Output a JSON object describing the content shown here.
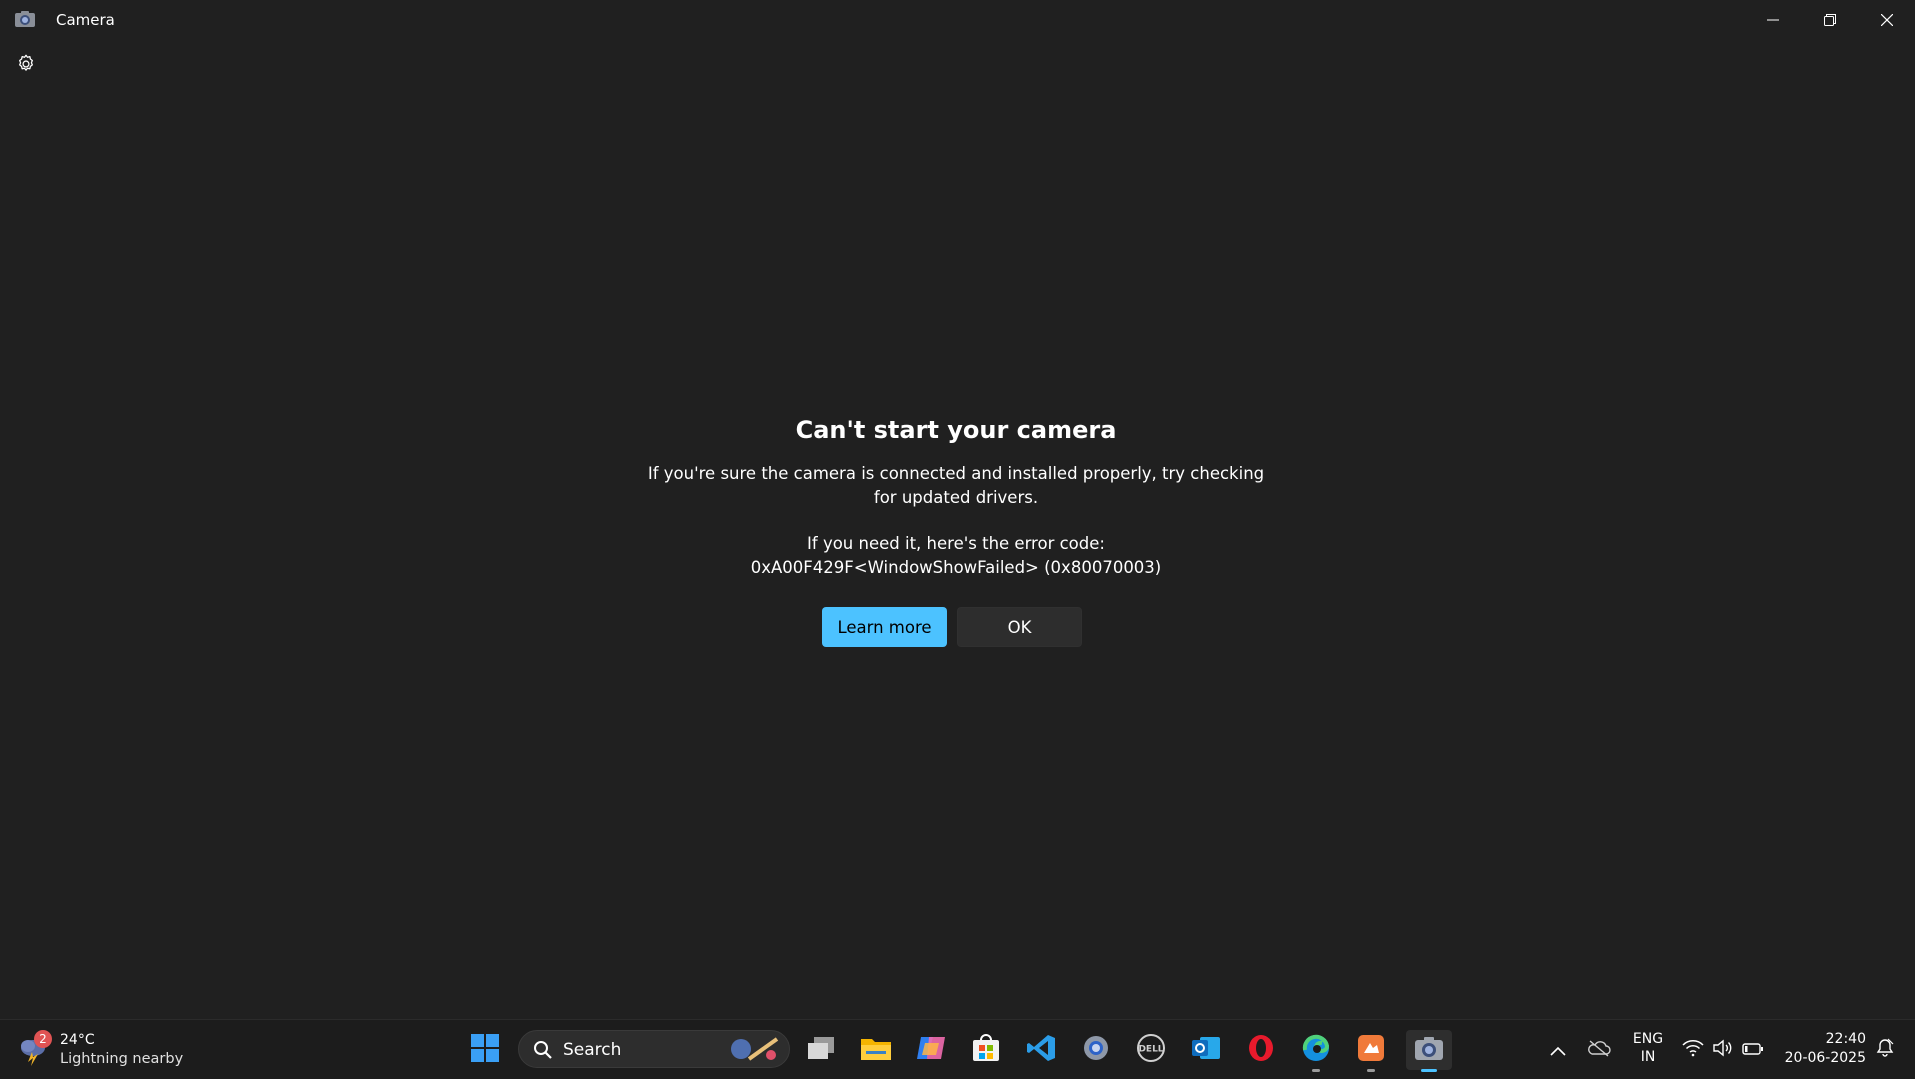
{
  "window": {
    "title": "Camera",
    "icon": "camera-icon",
    "controls": [
      "minimize-icon",
      "restore-icon",
      "close-icon"
    ]
  },
  "settings": {
    "icon": "gear-icon"
  },
  "dialog": {
    "title": "Can't start your camera",
    "message_line1": "If you're sure the camera is connected and installed properly, try checking for updated drivers.",
    "error_intro": "If you need it, here's the error code:",
    "error_code": "0xA00F429F<WindowShowFailed> (0x80070003)",
    "learn_more_label": "Learn more",
    "ok_label": "OK"
  },
  "taskbar": {
    "weather": {
      "temp": "24°C",
      "desc": "Lightning nearby",
      "badge": "2",
      "icon": "thunderstorm-icon"
    },
    "search": {
      "label": "Search"
    },
    "apps": [
      "windows-start-icon",
      "task-view-icon",
      "file-explorer-icon",
      "copilot-icon",
      "microsoft-store-icon",
      "vscode-icon",
      "settings-app-icon",
      "dell-icon",
      "outlook-icon",
      "opera-icon",
      "edge-icon",
      "office-lens-icon",
      "camera-app-icon"
    ],
    "tray": {
      "lang_line1": "ENG",
      "lang_line2": "IN",
      "time": "22:40",
      "date": "20-06-2025"
    }
  },
  "colors": {
    "background": "#202020",
    "accent": "#4cc2ff",
    "taskbar": "#1c1c1c"
  }
}
